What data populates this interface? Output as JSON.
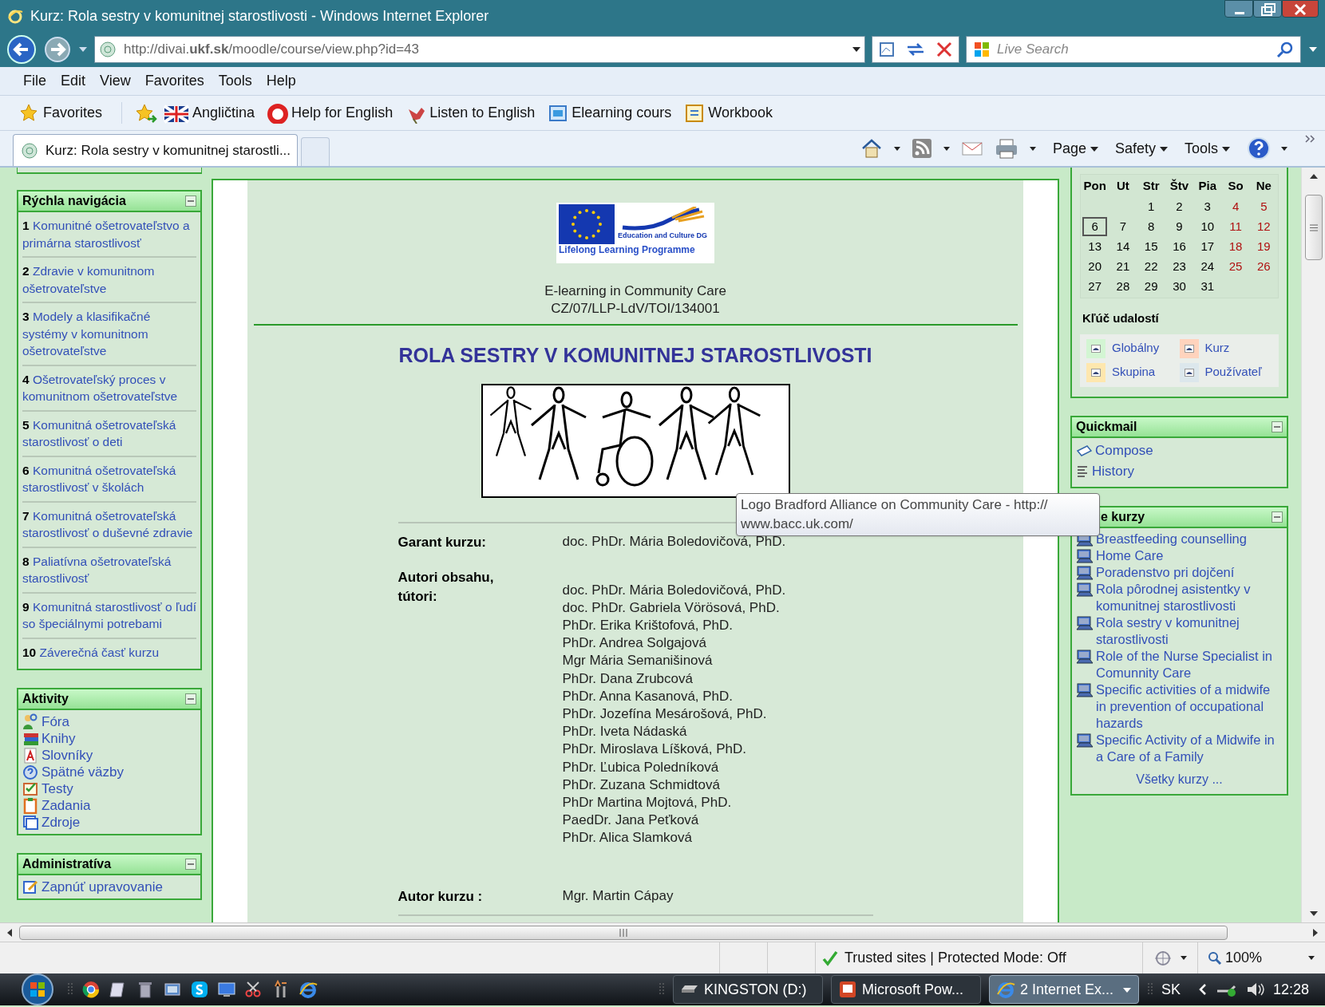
{
  "window": {
    "title": "Kurz: Rola sestry v komunitnej starostlivosti - Windows Internet Explorer"
  },
  "address_bar": {
    "url": "http://divai.**ukf.sk**/moodle/course/view.php?id=43"
  },
  "search": {
    "placeholder": "Live Search"
  },
  "menu": [
    "File",
    "Edit",
    "View",
    "Favorites",
    "Tools",
    "Help"
  ],
  "favorites_bar": [
    {
      "label": "Favorites"
    },
    {
      "label": "Angličtina"
    },
    {
      "label": "Help for English"
    },
    {
      "label": "Listen to English"
    },
    {
      "label": "Elearning cours"
    },
    {
      "label": "Workbook"
    }
  ],
  "tabs": [
    {
      "label": "Kurz: Rola sestry v komunitnej starostli...",
      "selected": true
    }
  ],
  "command_bar": [
    "Page",
    "Safety",
    "Tools"
  ],
  "left_blocks": [
    {
      "kind": "sections",
      "title": "Rýchla navigácia",
      "items": [
        {
          "number": "1",
          "text": "Komunitné ošetrovateľstvo a primárna starostlivosť"
        },
        {
          "number": "2",
          "text": "Zdravie v komunitnom ošetrovateľstve"
        },
        {
          "number": "3",
          "text": "Modely a klasifikačné systémy v komunitnom ošetrovateľstve"
        },
        {
          "number": "4",
          "text": "Ošetrovateľský proces v komunitnom ošetrovateľstve"
        },
        {
          "number": "5",
          "text": "Komunitná ošetrovateľská starostlivosť o deti"
        },
        {
          "number": "6",
          "text": "Komunitná ošetrovateľská starostlivosť v školách"
        },
        {
          "number": "7",
          "text": "Komunitná ošetrovateľská starostlivosť o duševné zdravie"
        },
        {
          "number": "8",
          "text": "Paliatívna ošetrovateľská starostlivosť"
        },
        {
          "number": "9",
          "text": "Komunitná starostlivosť o ľudí so špeciálnymi potrebami"
        },
        {
          "number": "10",
          "text": "Záverečná časť kurzu"
        }
      ]
    },
    {
      "kind": "activities",
      "title": "Aktivity",
      "items": [
        {
          "text": "Fóra"
        },
        {
          "text": "Knihy"
        },
        {
          "text": "Slovníky"
        },
        {
          "text": "Spätné väzby"
        },
        {
          "text": "Testy"
        },
        {
          "text": "Zadania"
        },
        {
          "text": "Zdroje"
        }
      ]
    },
    {
      "kind": "admin",
      "title": "Administratíva",
      "items": [
        {
          "text": "Zapnúť upravovanie"
        }
      ]
    }
  ],
  "main": {
    "logo": {
      "caption": "Education and Culture DG",
      "programme": "Lifelong Learning Programme"
    },
    "project": "E-learning in Community Care",
    "code": "CZ/07/LLP-LdV/TOI/134001",
    "heading": "ROLA SESTRY V KOMUNITNEJ STAROSTLIVOSTI",
    "info": [
      {
        "label": "Garant kurzu:",
        "values": [
          "doc. PhDr. Mária Boledovičová, PhD."
        ]
      },
      {
        "label": "Autori obsahu, tútori:",
        "values": [
          "doc. PhDr. Mária Boledovičová, PhD.",
          "doc. PhDr. Gabriela Vörösová, PhD.",
          "PhDr. Erika Krištofová, PhD.",
          "PhDr. Andrea Solgajová",
          "Mgr Mária Semanišinová",
          "PhDr. Dana Zrubcová",
          "PhDr. Anna Kasanová, PhD.",
          "PhDr. Jozefína Mesárošová, PhD.",
          "PhDr. Iveta Nádaská",
          "PhDr. Miroslava Líšková, PhD.",
          "PhDr. Ľubica Poledníková",
          "PhDr. Zuzana Schmidtová",
          "PhDr Martina Mojtová, PhD.",
          "PaedDr. Jana Peťková",
          "PhDr. Alica Slamková"
        ]
      },
      {
        "label": "Autor kurzu :",
        "values": [
          "Mgr. Martin Cápay"
        ]
      }
    ]
  },
  "tooltip": [
    "Logo Bradford Alliance on Community Care - http://",
    "www.bacc.uk.com/"
  ],
  "calendar": {
    "weekdays": [
      "Pon",
      "Ut",
      "Str",
      "Štv",
      "Pia",
      "So",
      "Ne"
    ],
    "weeks": [
      [
        {
          "kind": "blank"
        },
        {
          "kind": "blank"
        },
        {
          "kind": "day",
          "day": "1",
          "today": false,
          "weekend": false
        },
        {
          "kind": "day",
          "day": "2",
          "today": false,
          "weekend": false
        },
        {
          "kind": "day",
          "day": "3",
          "today": false,
          "weekend": false
        },
        {
          "kind": "day",
          "day": "4",
          "today": false,
          "weekend": true
        },
        {
          "kind": "day",
          "day": "5",
          "today": false,
          "weekend": true
        }
      ],
      [
        {
          "kind": "day",
          "day": "6",
          "today": true,
          "weekend": false
        },
        {
          "kind": "day",
          "day": "7",
          "today": false,
          "weekend": false
        },
        {
          "kind": "day",
          "day": "8",
          "today": false,
          "weekend": false
        },
        {
          "kind": "day",
          "day": "9",
          "today": false,
          "weekend": false
        },
        {
          "kind": "day",
          "day": "10",
          "today": false,
          "weekend": false
        },
        {
          "kind": "day",
          "day": "11",
          "today": false,
          "weekend": true
        },
        {
          "kind": "day",
          "day": "12",
          "today": false,
          "weekend": true
        }
      ],
      [
        {
          "kind": "day",
          "day": "13",
          "today": false,
          "weekend": false
        },
        {
          "kind": "day",
          "day": "14",
          "today": false,
          "weekend": false
        },
        {
          "kind": "day",
          "day": "15",
          "today": false,
          "weekend": false
        },
        {
          "kind": "day",
          "day": "16",
          "today": false,
          "weekend": false
        },
        {
          "kind": "day",
          "day": "17",
          "today": false,
          "weekend": false
        },
        {
          "kind": "day",
          "day": "18",
          "today": false,
          "weekend": true
        },
        {
          "kind": "day",
          "day": "19",
          "today": false,
          "weekend": true
        }
      ],
      [
        {
          "kind": "day",
          "day": "20",
          "today": false,
          "weekend": false
        },
        {
          "kind": "day",
          "day": "21",
          "today": false,
          "weekend": false
        },
        {
          "kind": "day",
          "day": "22",
          "today": false,
          "weekend": false
        },
        {
          "kind": "day",
          "day": "23",
          "today": false,
          "weekend": false
        },
        {
          "kind": "day",
          "day": "24",
          "today": false,
          "weekend": false
        },
        {
          "kind": "day",
          "day": "25",
          "today": false,
          "weekend": true
        },
        {
          "kind": "day",
          "day": "26",
          "today": false,
          "weekend": true
        }
      ],
      [
        {
          "kind": "day",
          "day": "27",
          "today": false,
          "weekend": false
        },
        {
          "kind": "day",
          "day": "28",
          "today": false,
          "weekend": false
        },
        {
          "kind": "day",
          "day": "29",
          "today": false,
          "weekend": false
        },
        {
          "kind": "day",
          "day": "30",
          "today": false,
          "weekend": false
        },
        {
          "kind": "day",
          "day": "31",
          "today": false,
          "weekend": false
        },
        {
          "kind": "blank"
        },
        {
          "kind": "blank"
        }
      ]
    ],
    "key_title": "Kľúč udalostí",
    "key": [
      {
        "label": "Globálny",
        "color": "#d3f5d3"
      },
      {
        "label": "Kurz",
        "color": "#ffd3bd"
      },
      {
        "label": "Skupina",
        "color": "#fee7ae"
      },
      {
        "label": "Používateľ",
        "color": "#dce7ec"
      }
    ]
  },
  "right_blocks": [
    {
      "kind": "mail",
      "title": "Quickmail",
      "items": [
        {
          "text": "Compose"
        },
        {
          "text": "History"
        }
      ]
    },
    {
      "kind": "courses",
      "title": "e kurzy",
      "items": [
        {
          "text": "Breastfeeding counselling"
        },
        {
          "text": "Home Care"
        },
        {
          "text": "Poradenstvo pri dojčení"
        },
        {
          "text": "Rola pôrodnej asistentky v komunitnej starostlivosti"
        },
        {
          "text": "Rola sestry v komunitnej starostlivosti"
        },
        {
          "text": "Role of the Nurse Specialist in Comunnity Care"
        },
        {
          "text": "Specific activities of a midwife in prevention of occupational hazards"
        },
        {
          "text": "Specific Activity of a Midwife in a Care of a Family"
        }
      ],
      "footer": "Všetky kurzy ..."
    }
  ],
  "status_bar": {
    "zone": "Trusted sites | Protected Mode: Off",
    "zoom": "100%"
  },
  "taskbar": {
    "buttons": [
      {
        "label": "KINGSTON (D:)",
        "selected": false
      },
      {
        "label": "Microsoft Pow...",
        "selected": false
      },
      {
        "label": "2 Internet Ex...",
        "selected": true
      }
    ],
    "language": "SK",
    "clock": "12:28"
  }
}
